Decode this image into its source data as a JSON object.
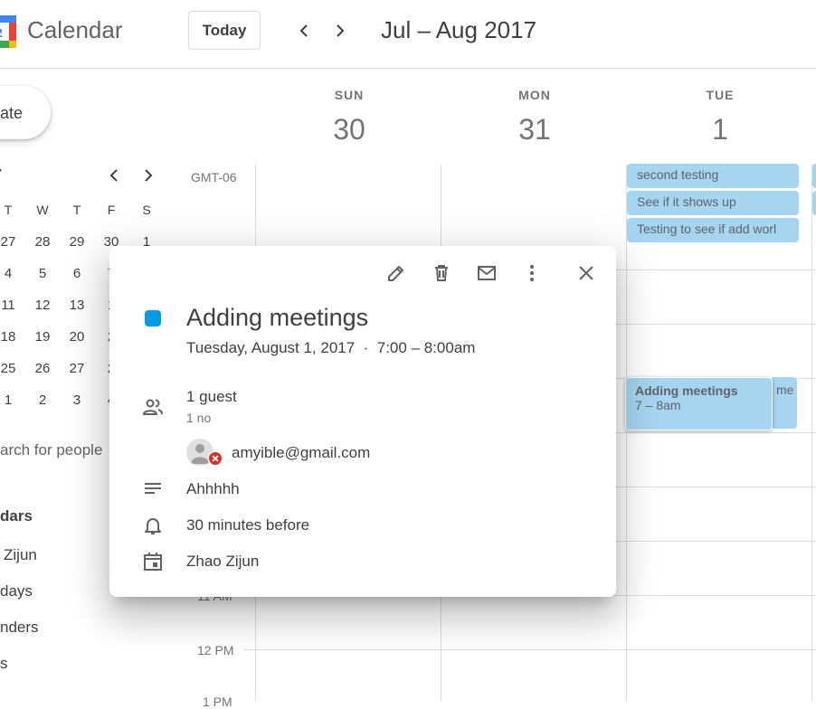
{
  "header": {
    "app_title": "Calendar",
    "today_label": "Today",
    "date_range": "Jul – Aug 2017"
  },
  "sidebar": {
    "create_label": "ate",
    "mini_calendar": {
      "month_fragment": "7",
      "weekday_headers": [
        "T",
        "W",
        "T",
        "F",
        "S"
      ],
      "rows": [
        [
          "27",
          "28",
          "29",
          "30",
          "1"
        ],
        [
          "4",
          "5",
          "6",
          "7"
        ],
        [
          "11",
          "12",
          "13",
          "1"
        ],
        [
          "18",
          "19",
          "20",
          "2"
        ],
        [
          "25",
          "26",
          "27",
          "2"
        ],
        [
          "1",
          "2",
          "3",
          "4"
        ]
      ]
    },
    "search_people": "arch for people",
    "section_title": "dars",
    "calendar_items": [
      "Zijun",
      "days",
      "nders",
      "s"
    ]
  },
  "week": {
    "timezone": "GMT-06",
    "days": [
      {
        "dow": "SUN",
        "num": "30"
      },
      {
        "dow": "MON",
        "num": "31"
      },
      {
        "dow": "TUE",
        "num": "1"
      }
    ],
    "time_labels": {
      "t11": "11 AM",
      "t12": "12 PM",
      "t1": "1 PM"
    }
  },
  "events": {
    "e1": "second testing",
    "e2": "See if it shows up",
    "e3": "Testing to see if add worl",
    "selected_title": "Adding meetings",
    "selected_time": "7 – 8am",
    "partial": "me"
  },
  "popup": {
    "title": "Adding meetings",
    "datetime": "Tuesday, August 1, 2017  ·  7:00 – 8:00am",
    "guests_label": "1 guest",
    "guests_status": "1 no",
    "guest_email": "amyible@gmail.com",
    "description": "Ahhhhh",
    "reminder": "30 minutes before",
    "calendar_name": "Zhao Zijun",
    "color": "#039be5"
  }
}
